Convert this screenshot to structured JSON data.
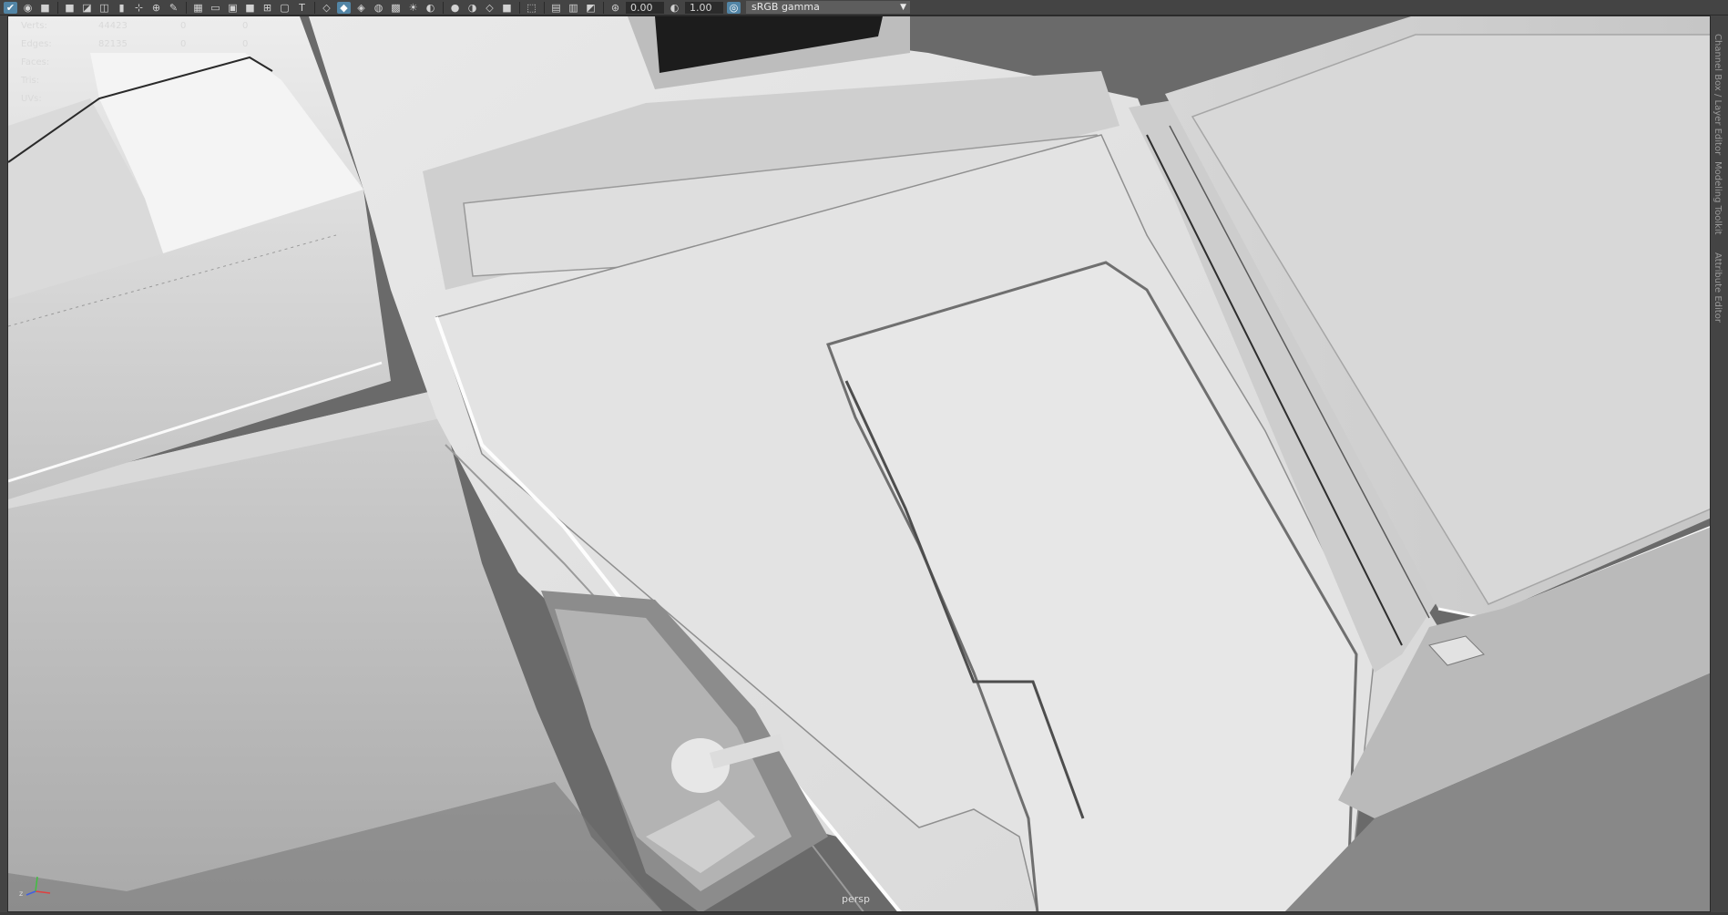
{
  "toolbar": {
    "exposure_value": "0.00",
    "gamma_value": "1.00",
    "color_space": "sRGB gamma",
    "icons": [
      "selection-mask-icon",
      "camera-icon",
      "camera-attributes-icon",
      "bookmark-icon",
      "image-plane-icon",
      "grid-icon",
      "film-gate-icon",
      "resolution-gate-icon",
      "gate-mask-icon",
      "field-chart-icon",
      "safe-action-icon",
      "safe-title-icon",
      "wireframe-icon",
      "smooth-shade-icon",
      "wireframe-on-shaded-icon",
      "textured-icon",
      "use-all-lights-icon",
      "shadows-icon",
      "xray-icon",
      "xray-active-icon",
      "screen-space-ambient-occlusion-icon",
      "motion-blur-icon",
      "anti-aliasing-icon",
      "depth-of-field-icon",
      "isolate-select-icon",
      "xray-joints-icon",
      "xray-active-components-icon",
      "exposure-icon",
      "gamma-icon",
      "color-management-icon"
    ]
  },
  "hud": {
    "rows": [
      {
        "label": "Verts:",
        "value": "44423",
        "selected": "0",
        "extra": "0"
      },
      {
        "label": "Edges:",
        "value": "82135",
        "selected": "0",
        "extra": "0"
      },
      {
        "label": "Faces:",
        "value": "",
        "selected": "",
        "extra": ""
      },
      {
        "label": "Tris:",
        "value": "",
        "selected": "",
        "extra": ""
      },
      {
        "label": "UVs:",
        "value": "",
        "selected": "",
        "extra": ""
      }
    ]
  },
  "viewport": {
    "camera_name": "persp"
  },
  "side_tabs": {
    "channel_box": "Channel Box / Layer Editor",
    "modeling_toolkit": "Modeling Toolkit",
    "attribute_editor": "Attribute Editor"
  },
  "colors": {
    "ui_background": "#444444",
    "active_button": "#5285a6",
    "viewport_bg": "#6b6b6b",
    "model_light": "#e6e6e6",
    "model_mid": "#bdbdbd",
    "model_dark": "#8a8a8a"
  }
}
